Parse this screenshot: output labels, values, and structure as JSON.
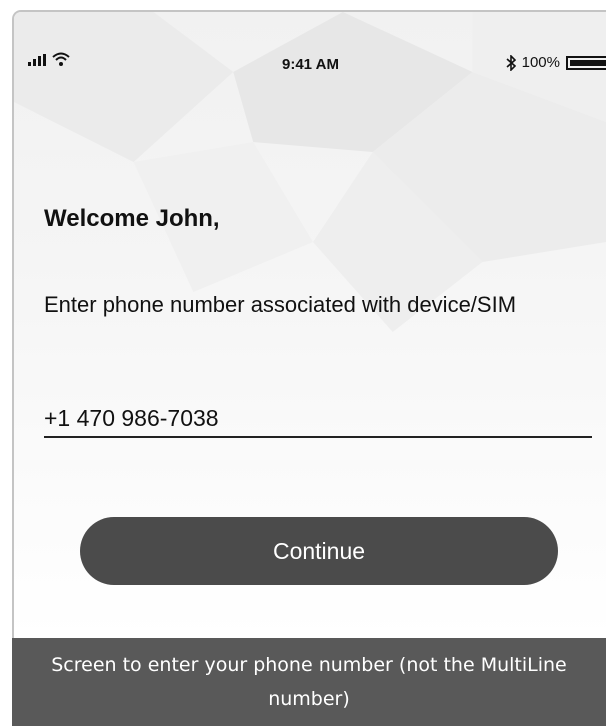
{
  "status_bar": {
    "time": "9:41 AM",
    "battery_percent": "100%",
    "icons": [
      "signal-icon",
      "wifi-icon",
      "bluetooth-icon",
      "battery-icon"
    ]
  },
  "main": {
    "greeting": "Welcome John,",
    "instruction": "Enter phone number associated with device/SIM",
    "phone_value": "+1 470 986-7038",
    "continue_label": "Continue"
  },
  "caption": {
    "text": "Screen to enter your phone number (not the MultiLine number)"
  },
  "colors": {
    "button_bg": "#4b4b4b",
    "caption_bg": "#595959"
  }
}
